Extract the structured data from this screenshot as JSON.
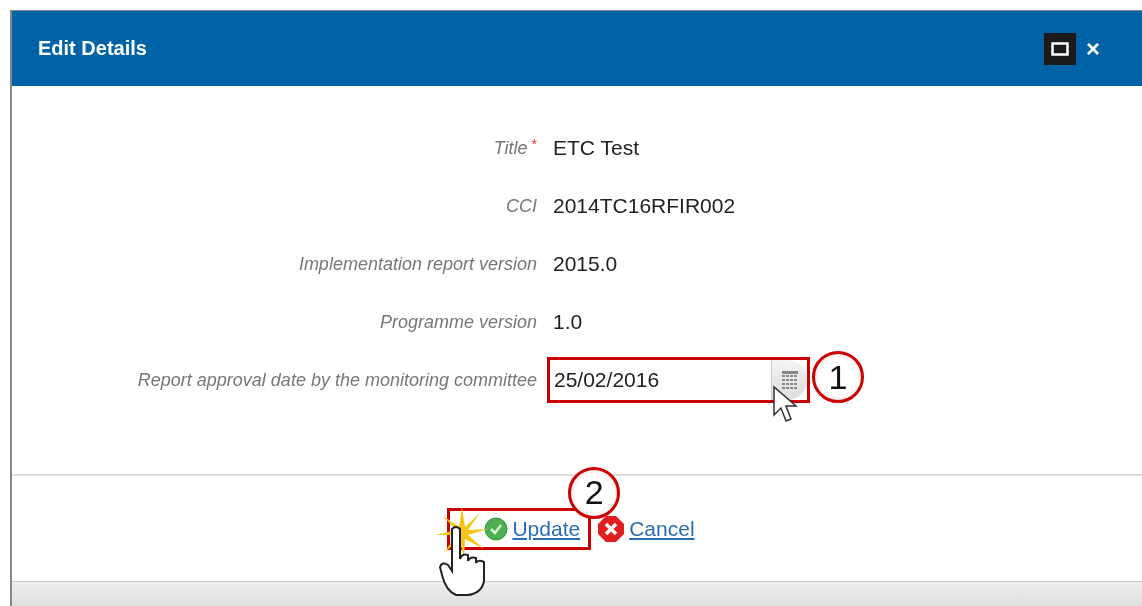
{
  "dialog": {
    "title": "Edit Details",
    "close_label": "×",
    "required_marker": "*"
  },
  "fields": [
    {
      "kind": "text",
      "label": "Title",
      "required": true,
      "value": "ETC Test"
    },
    {
      "kind": "text",
      "label": "CCI",
      "required": false,
      "value": "2014TC16RFIR002"
    },
    {
      "kind": "text",
      "label": "Implementation report version",
      "required": false,
      "value": "2015.0"
    },
    {
      "kind": "text",
      "label": "Programme version",
      "required": false,
      "value": "1.0"
    },
    {
      "kind": "date",
      "label": "Report approval date by the monitoring committee",
      "required": false,
      "value": "25/02/2016",
      "callout": "1"
    }
  ],
  "actions": [
    {
      "kind": "confirm",
      "label": "Update",
      "callout": "2"
    },
    {
      "kind": "cancel",
      "label": "Cancel"
    }
  ]
}
